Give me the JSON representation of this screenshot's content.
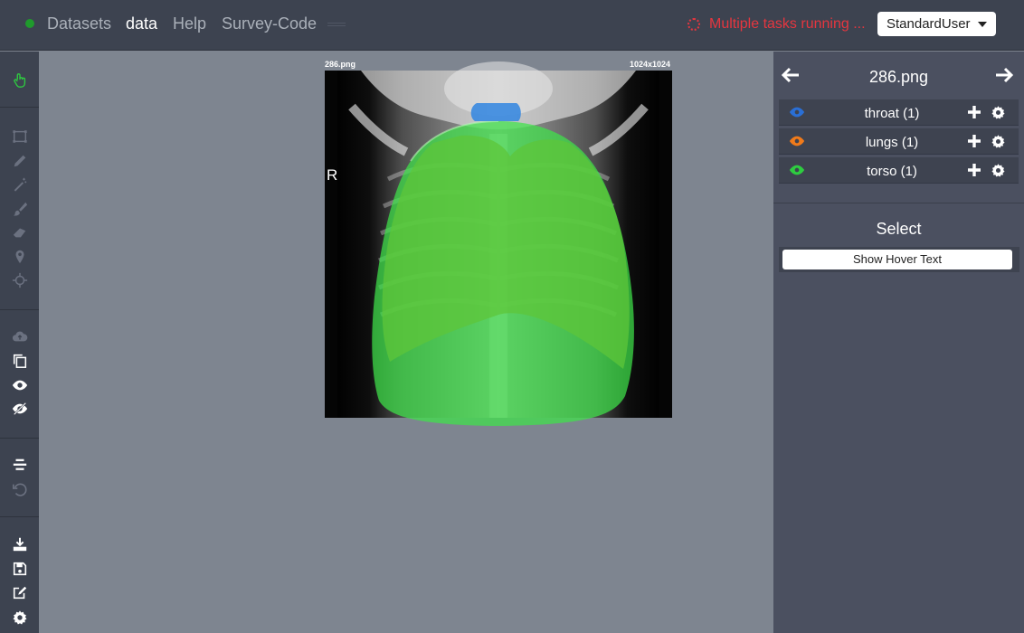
{
  "nav": {
    "links": [
      "Datasets",
      "data",
      "Help",
      "Survey-Code"
    ],
    "tasks_text": "Multiple tasks running ...",
    "user": "StandardUser"
  },
  "colors": {
    "accent_green": "#2ecc40",
    "task_red": "#e5363f",
    "throat": "#2a6fd6",
    "lungs": "#f07a1a",
    "torso": "#2ecc40"
  },
  "toolbar": {
    "icons": [
      "hand-pointer-icon",
      "bbox-icon",
      "pencil-icon",
      "magic-wand-icon",
      "brush-icon",
      "eraser-icon",
      "map-pin-icon",
      "crosshair-icon",
      "cloud-upload-icon",
      "copy-icon",
      "eye-icon",
      "eye-slash-icon",
      "align-center-icon",
      "undo-icon",
      "download-icon",
      "save-icon",
      "edit-icon",
      "settings-icon"
    ]
  },
  "canvas": {
    "filename": "286.png",
    "resolution": "1024x1024",
    "orientation_marker": "R"
  },
  "panel": {
    "title": "286.png",
    "categories": [
      {
        "label": "throat (1)",
        "color": "#2a6fd6"
      },
      {
        "label": "lungs (1)",
        "color": "#f07a1a"
      },
      {
        "label": "torso (1)",
        "color": "#2ecc40"
      }
    ],
    "select_title": "Select",
    "hover_button": "Show Hover Text"
  }
}
